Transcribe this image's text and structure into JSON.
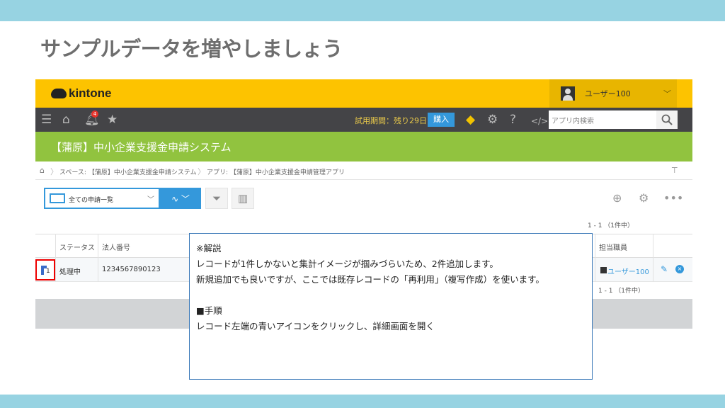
{
  "slide": {
    "title": "サンプルデータを増やしましょう"
  },
  "header": {
    "logo_text": "kintone",
    "user_name": "ユーザー100"
  },
  "nav": {
    "badge": "4",
    "trial_text": "試用期間：残り29日",
    "buy_label": "購入",
    "search_placeholder": "アプリ内検索"
  },
  "space": {
    "title": "【蒲原】中小企業支援金申請システム"
  },
  "breadcrumb": {
    "items": [
      "スペース: 【蒲原】中小企業支援金申請システム",
      "アプリ: 【蒲原】中小企業支援金申請管理アプリ"
    ]
  },
  "toolbar": {
    "view_label": "全ての申請一覧"
  },
  "list": {
    "count": "1 - 1 （1件中）",
    "columns": [
      "ステータス",
      "法人番号",
      "担当職員"
    ],
    "rows": [
      {
        "index": "1",
        "status": "処理中",
        "corp_number": "1234567890123",
        "staff": "ユーザー100"
      }
    ],
    "pager_bottom": "1 - 1 （1件中）"
  },
  "callout": {
    "lines": [
      "※解説",
      "レコードが1件しかないと集計イメージが掴みづらいため、2件追加します。",
      "新規追加でも良いですが、ここでは既存レコードの「再利用」（複写作成）を使います。",
      "",
      "■手順",
      "レコード左端の青いアイコンをクリックし、詳細画面を開く"
    ]
  },
  "colors": {
    "band": "#97d3e2",
    "topbar": "#fdc300",
    "navbar": "#444447",
    "space_bar": "#91c33f",
    "accent": "#3498db",
    "highlight": "#e00000"
  }
}
